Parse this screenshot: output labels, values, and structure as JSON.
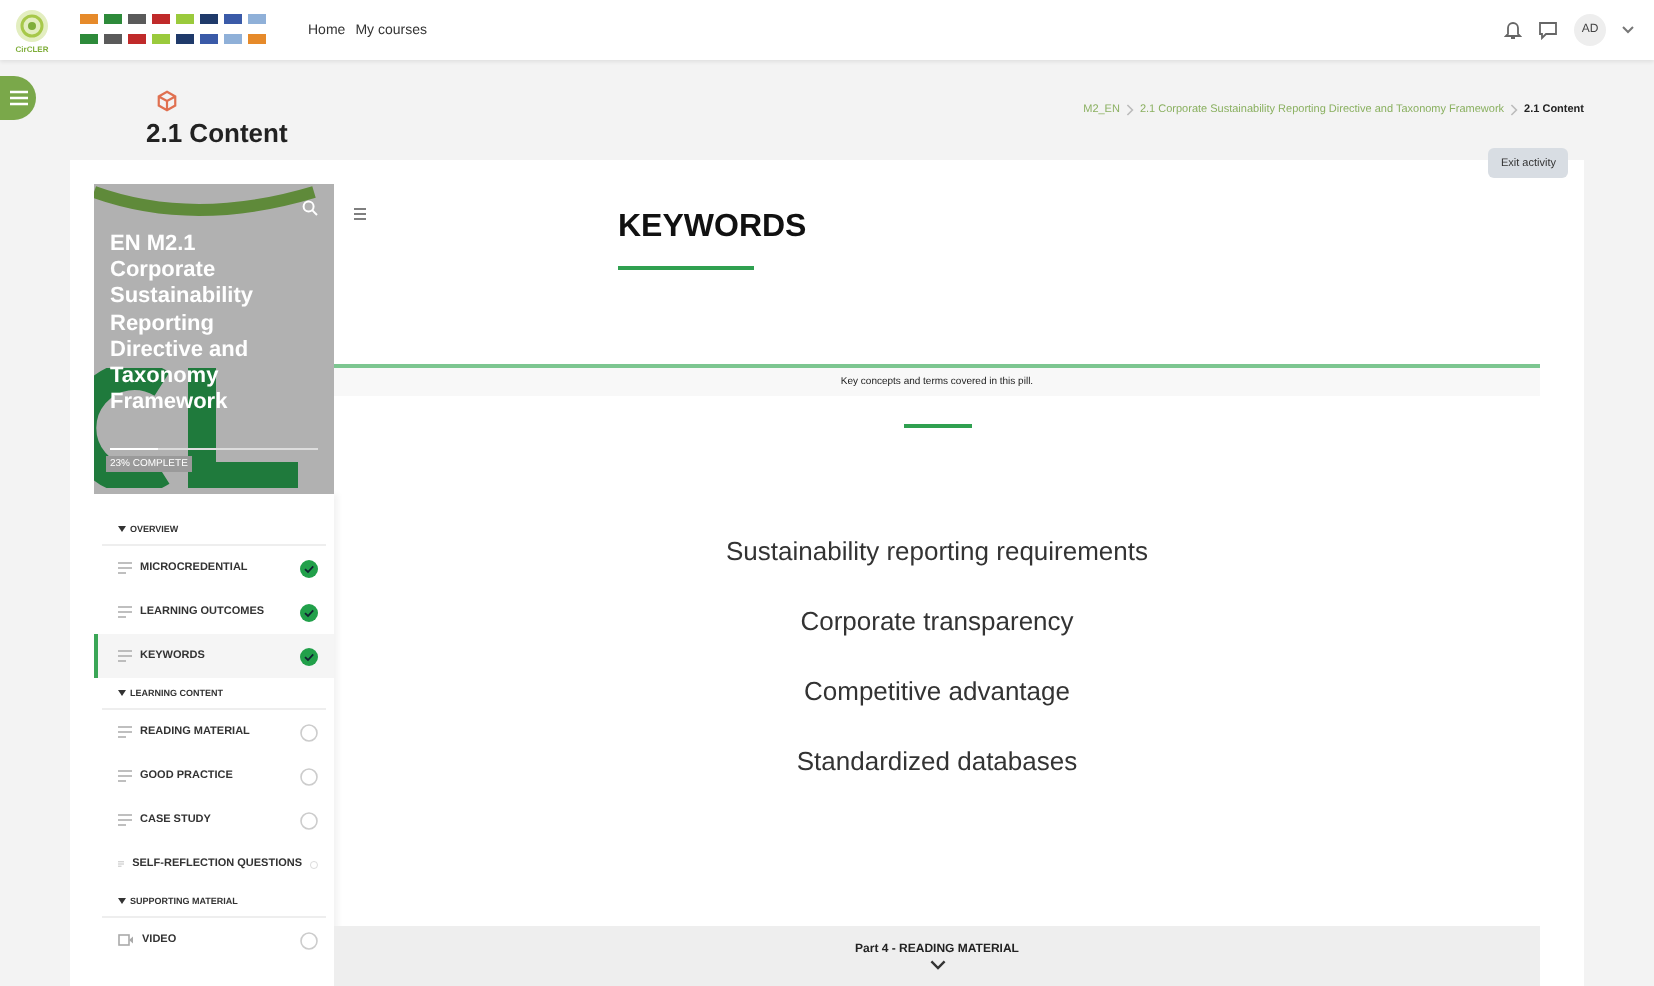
{
  "header": {
    "logo_text": "CirCLER",
    "nav": [
      {
        "label": "Home"
      },
      {
        "label": "My courses"
      }
    ],
    "user_initials": "AD"
  },
  "page": {
    "title": "2.1 Content",
    "breadcrumb": [
      {
        "label": "M2_EN",
        "current": false
      },
      {
        "label": "2.1 Corporate Sustainability Reporting Directive and Taxonomy Framework",
        "current": false
      },
      {
        "label": "2.1 Content",
        "current": true
      }
    ],
    "exit_button": "Exit activity"
  },
  "sidebar": {
    "course_title": "EN M2.1 Corporate Sustainability Reporting Directive and Taxonomy Framework",
    "progress_text": "23% COMPLETE",
    "level": 0.23,
    "items": [
      {
        "kind": "section",
        "label": "OVERVIEW"
      },
      {
        "kind": "page",
        "label": "MICROCREDENTIAL",
        "done": true,
        "selected": false
      },
      {
        "kind": "page",
        "label": "LEARNING OUTCOMES",
        "done": true,
        "selected": false
      },
      {
        "kind": "page",
        "label": "KEYWORDS",
        "done": true,
        "selected": true
      },
      {
        "kind": "section",
        "label": "LEARNING CONTENT"
      },
      {
        "kind": "page",
        "label": "READING MATERIAL",
        "done": false,
        "selected": false
      },
      {
        "kind": "page",
        "label": "GOOD PRACTICE",
        "done": false,
        "selected": false
      },
      {
        "kind": "page",
        "label": "CASE STUDY",
        "done": false,
        "selected": false
      },
      {
        "kind": "page",
        "label": "SELF-REFLECTION QUESTIONS",
        "done": false,
        "selected": false
      },
      {
        "kind": "section",
        "label": "SUPPORTING MATERIAL"
      },
      {
        "kind": "video",
        "label": "VIDEO",
        "done": false,
        "selected": false
      }
    ]
  },
  "content": {
    "heading": "KEYWORDS",
    "subtitle": "Key concepts and terms covered in this pill.",
    "keywords": [
      "Sustainability reporting requirements",
      "Corporate transparency",
      "Competitive advantage",
      "Standardized databases"
    ],
    "next_part": "Part 4 - READING MATERIAL"
  }
}
